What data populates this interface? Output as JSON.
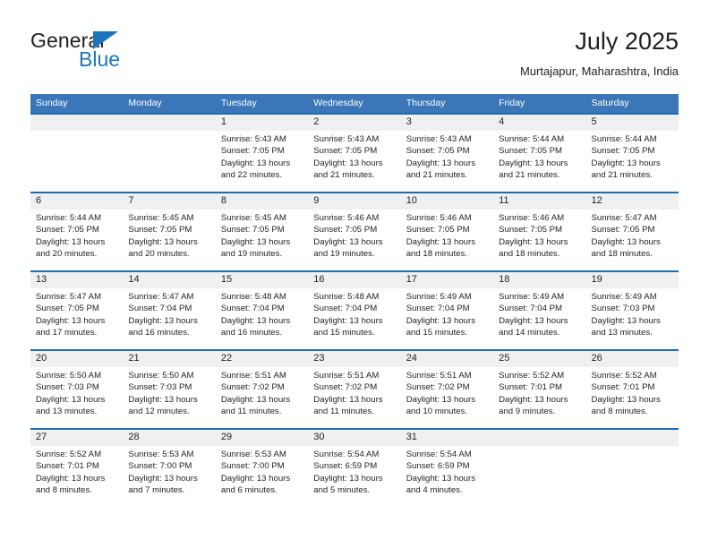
{
  "brand": {
    "word_one": "General",
    "word_two": "Blue",
    "triangle_color": "#1b75bb",
    "logo_icon": "triangle-icon"
  },
  "header": {
    "title": "July 2025",
    "subtitle": "Murtajapur, Maharashtra, India"
  },
  "colors": {
    "header_blue": "#3a76b8",
    "separator_blue": "#1b6cb0",
    "daynum_band": "#f0f0f0",
    "text": "#231f20",
    "brand_blue": "#1b75bb"
  },
  "labels": {
    "sunrise_prefix": "Sunrise:",
    "sunset_prefix": "Sunset:",
    "daylight_prefix": "Daylight:"
  },
  "weekdays": [
    "Sunday",
    "Monday",
    "Tuesday",
    "Wednesday",
    "Thursday",
    "Friday",
    "Saturday"
  ],
  "weeks": [
    [
      {
        "day": "",
        "empty": true
      },
      {
        "day": "",
        "empty": true
      },
      {
        "day": "1",
        "sunrise": "Sunrise: 5:43 AM",
        "sunset": "Sunset: 7:05 PM",
        "daylight_1": "Daylight: 13 hours",
        "daylight_2": "and 22 minutes."
      },
      {
        "day": "2",
        "sunrise": "Sunrise: 5:43 AM",
        "sunset": "Sunset: 7:05 PM",
        "daylight_1": "Daylight: 13 hours",
        "daylight_2": "and 21 minutes."
      },
      {
        "day": "3",
        "sunrise": "Sunrise: 5:43 AM",
        "sunset": "Sunset: 7:05 PM",
        "daylight_1": "Daylight: 13 hours",
        "daylight_2": "and 21 minutes."
      },
      {
        "day": "4",
        "sunrise": "Sunrise: 5:44 AM",
        "sunset": "Sunset: 7:05 PM",
        "daylight_1": "Daylight: 13 hours",
        "daylight_2": "and 21 minutes."
      },
      {
        "day": "5",
        "sunrise": "Sunrise: 5:44 AM",
        "sunset": "Sunset: 7:05 PM",
        "daylight_1": "Daylight: 13 hours",
        "daylight_2": "and 21 minutes."
      }
    ],
    [
      {
        "day": "6",
        "sunrise": "Sunrise: 5:44 AM",
        "sunset": "Sunset: 7:05 PM",
        "daylight_1": "Daylight: 13 hours",
        "daylight_2": "and 20 minutes."
      },
      {
        "day": "7",
        "sunrise": "Sunrise: 5:45 AM",
        "sunset": "Sunset: 7:05 PM",
        "daylight_1": "Daylight: 13 hours",
        "daylight_2": "and 20 minutes."
      },
      {
        "day": "8",
        "sunrise": "Sunrise: 5:45 AM",
        "sunset": "Sunset: 7:05 PM",
        "daylight_1": "Daylight: 13 hours",
        "daylight_2": "and 19 minutes."
      },
      {
        "day": "9",
        "sunrise": "Sunrise: 5:46 AM",
        "sunset": "Sunset: 7:05 PM",
        "daylight_1": "Daylight: 13 hours",
        "daylight_2": "and 19 minutes."
      },
      {
        "day": "10",
        "sunrise": "Sunrise: 5:46 AM",
        "sunset": "Sunset: 7:05 PM",
        "daylight_1": "Daylight: 13 hours",
        "daylight_2": "and 18 minutes."
      },
      {
        "day": "11",
        "sunrise": "Sunrise: 5:46 AM",
        "sunset": "Sunset: 7:05 PM",
        "daylight_1": "Daylight: 13 hours",
        "daylight_2": "and 18 minutes."
      },
      {
        "day": "12",
        "sunrise": "Sunrise: 5:47 AM",
        "sunset": "Sunset: 7:05 PM",
        "daylight_1": "Daylight: 13 hours",
        "daylight_2": "and 18 minutes."
      }
    ],
    [
      {
        "day": "13",
        "sunrise": "Sunrise: 5:47 AM",
        "sunset": "Sunset: 7:05 PM",
        "daylight_1": "Daylight: 13 hours",
        "daylight_2": "and 17 minutes."
      },
      {
        "day": "14",
        "sunrise": "Sunrise: 5:47 AM",
        "sunset": "Sunset: 7:04 PM",
        "daylight_1": "Daylight: 13 hours",
        "daylight_2": "and 16 minutes."
      },
      {
        "day": "15",
        "sunrise": "Sunrise: 5:48 AM",
        "sunset": "Sunset: 7:04 PM",
        "daylight_1": "Daylight: 13 hours",
        "daylight_2": "and 16 minutes."
      },
      {
        "day": "16",
        "sunrise": "Sunrise: 5:48 AM",
        "sunset": "Sunset: 7:04 PM",
        "daylight_1": "Daylight: 13 hours",
        "daylight_2": "and 15 minutes."
      },
      {
        "day": "17",
        "sunrise": "Sunrise: 5:49 AM",
        "sunset": "Sunset: 7:04 PM",
        "daylight_1": "Daylight: 13 hours",
        "daylight_2": "and 15 minutes."
      },
      {
        "day": "18",
        "sunrise": "Sunrise: 5:49 AM",
        "sunset": "Sunset: 7:04 PM",
        "daylight_1": "Daylight: 13 hours",
        "daylight_2": "and 14 minutes."
      },
      {
        "day": "19",
        "sunrise": "Sunrise: 5:49 AM",
        "sunset": "Sunset: 7:03 PM",
        "daylight_1": "Daylight: 13 hours",
        "daylight_2": "and 13 minutes."
      }
    ],
    [
      {
        "day": "20",
        "sunrise": "Sunrise: 5:50 AM",
        "sunset": "Sunset: 7:03 PM",
        "daylight_1": "Daylight: 13 hours",
        "daylight_2": "and 13 minutes."
      },
      {
        "day": "21",
        "sunrise": "Sunrise: 5:50 AM",
        "sunset": "Sunset: 7:03 PM",
        "daylight_1": "Daylight: 13 hours",
        "daylight_2": "and 12 minutes."
      },
      {
        "day": "22",
        "sunrise": "Sunrise: 5:51 AM",
        "sunset": "Sunset: 7:02 PM",
        "daylight_1": "Daylight: 13 hours",
        "daylight_2": "and 11 minutes."
      },
      {
        "day": "23",
        "sunrise": "Sunrise: 5:51 AM",
        "sunset": "Sunset: 7:02 PM",
        "daylight_1": "Daylight: 13 hours",
        "daylight_2": "and 11 minutes."
      },
      {
        "day": "24",
        "sunrise": "Sunrise: 5:51 AM",
        "sunset": "Sunset: 7:02 PM",
        "daylight_1": "Daylight: 13 hours",
        "daylight_2": "and 10 minutes."
      },
      {
        "day": "25",
        "sunrise": "Sunrise: 5:52 AM",
        "sunset": "Sunset: 7:01 PM",
        "daylight_1": "Daylight: 13 hours",
        "daylight_2": "and 9 minutes."
      },
      {
        "day": "26",
        "sunrise": "Sunrise: 5:52 AM",
        "sunset": "Sunset: 7:01 PM",
        "daylight_1": "Daylight: 13 hours",
        "daylight_2": "and 8 minutes."
      }
    ],
    [
      {
        "day": "27",
        "sunrise": "Sunrise: 5:52 AM",
        "sunset": "Sunset: 7:01 PM",
        "daylight_1": "Daylight: 13 hours",
        "daylight_2": "and 8 minutes."
      },
      {
        "day": "28",
        "sunrise": "Sunrise: 5:53 AM",
        "sunset": "Sunset: 7:00 PM",
        "daylight_1": "Daylight: 13 hours",
        "daylight_2": "and 7 minutes."
      },
      {
        "day": "29",
        "sunrise": "Sunrise: 5:53 AM",
        "sunset": "Sunset: 7:00 PM",
        "daylight_1": "Daylight: 13 hours",
        "daylight_2": "and 6 minutes."
      },
      {
        "day": "30",
        "sunrise": "Sunrise: 5:54 AM",
        "sunset": "Sunset: 6:59 PM",
        "daylight_1": "Daylight: 13 hours",
        "daylight_2": "and 5 minutes."
      },
      {
        "day": "31",
        "sunrise": "Sunrise: 5:54 AM",
        "sunset": "Sunset: 6:59 PM",
        "daylight_1": "Daylight: 13 hours",
        "daylight_2": "and 4 minutes."
      },
      {
        "day": "",
        "empty": true
      },
      {
        "day": "",
        "empty": true
      }
    ]
  ]
}
